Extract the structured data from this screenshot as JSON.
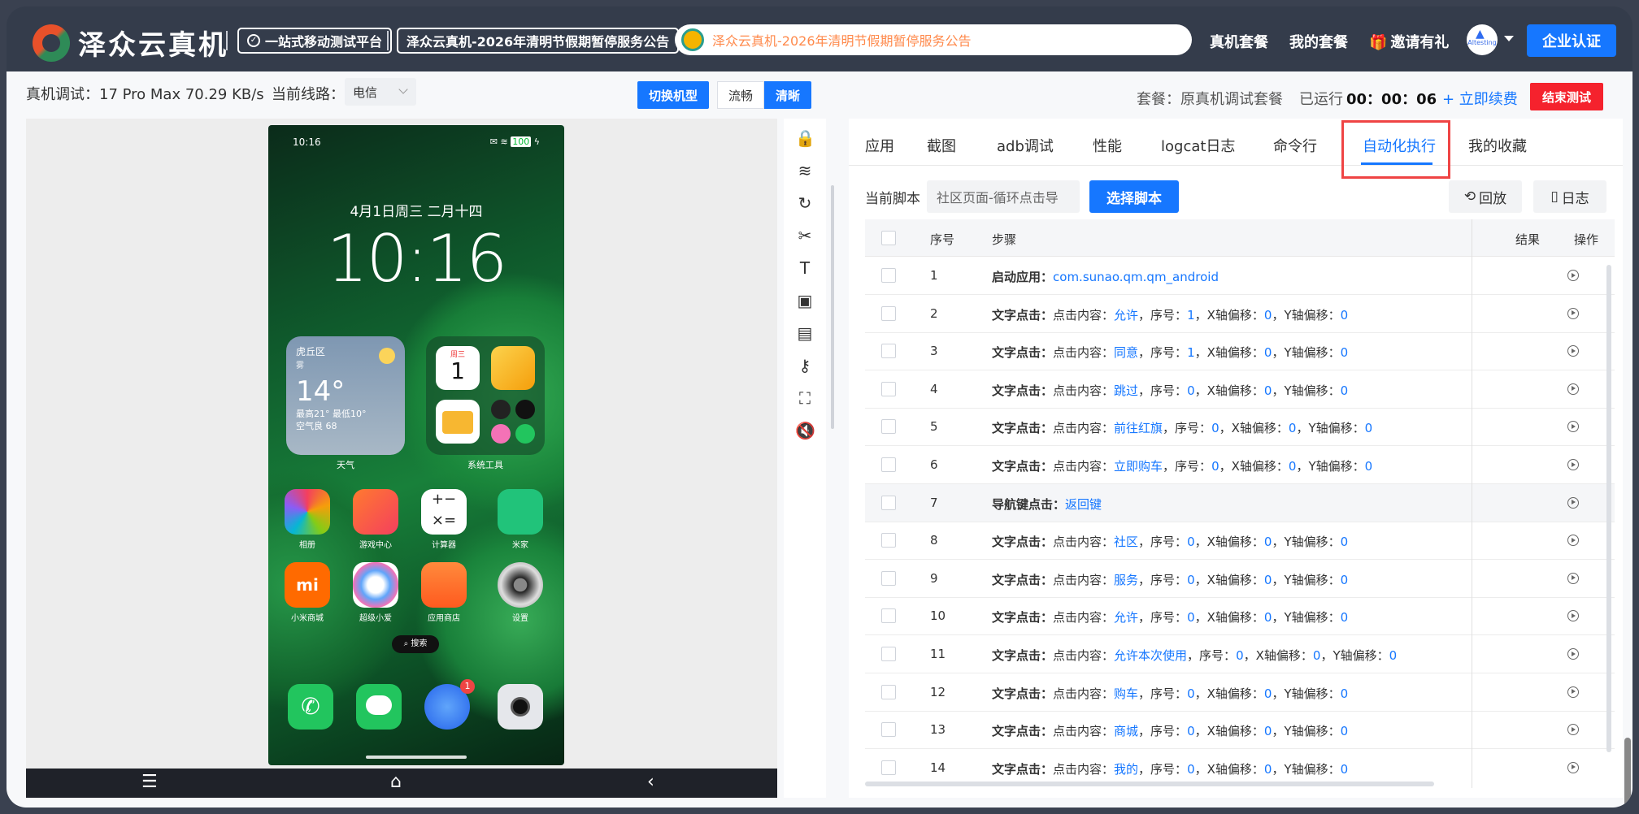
{
  "header": {
    "logo_text": "泽众云真机",
    "tagline": "一站式移动测试平台",
    "announcement_title": "泽众云真机-2026年清明节假期暂停服务公告",
    "notice_text": "泽众云真机-2026年清明节假期暂停服务公告",
    "nav": [
      "真机套餐",
      "我的套餐",
      "邀请有礼"
    ],
    "avatar_text": "Altesting",
    "enterprise_label": "企业认证"
  },
  "device_bar": {
    "info": "真机调试：17 Pro Max  70.29 KB/s",
    "line_label": "当前线路：",
    "line_value": "电信",
    "switch_label": "切换机型",
    "quality_smooth": "流畅",
    "quality_hd": "清晰"
  },
  "session": {
    "plan": "套餐：原真机调试套餐",
    "running_label": "已运行",
    "running_time": "00：00：06",
    "renew_label": "+ 立即续费",
    "end_label": "结束测试"
  },
  "phone": {
    "status_time": "10:16",
    "battery": "100",
    "date": "4月1日周三 二月十四",
    "clock": "10:16",
    "weather_city": "虎丘区",
    "weather_cond": "雾",
    "weather_temp": "14°",
    "weather_range": "最高21° 最低10°",
    "weather_aqi": "空气良 68",
    "weather_label": "天气",
    "tools_label": "系统工具",
    "cal_day": "周三",
    "cal_num": "1",
    "apps_row1": [
      "相册",
      "游戏中心",
      "计算器",
      "米家"
    ],
    "apps_row2": [
      "小米商城",
      "超级小爱",
      "应用商店",
      "设置"
    ],
    "search": "搜索",
    "badge": "1"
  },
  "tabs": [
    "应用",
    "截图",
    "adb调试",
    "性能",
    "logcat日志",
    "命令行",
    "自动化执行",
    "我的收藏"
  ],
  "script": {
    "label": "当前脚本",
    "value": "社区页面-循环点击导",
    "pick_label": "选择脚本",
    "replay_label": "回放",
    "log_label": "日志"
  },
  "table": {
    "columns": [
      "序号",
      "步骤",
      "结果",
      "操作"
    ],
    "rows": [
      {
        "no": "1",
        "type": "启动应用：",
        "text": "com.sunao.qm.qm_android"
      },
      {
        "no": "2",
        "type": "文字点击：",
        "content": "允许",
        "seq": "1",
        "x": "0",
        "y": "0"
      },
      {
        "no": "3",
        "type": "文字点击：",
        "content": "同意",
        "seq": "1",
        "x": "0",
        "y": "0"
      },
      {
        "no": "4",
        "type": "文字点击：",
        "content": "跳过",
        "seq": "0",
        "x": "0",
        "y": "0"
      },
      {
        "no": "5",
        "type": "文字点击：",
        "content": "前往红旗",
        "seq": "0",
        "x": "0",
        "y": "0"
      },
      {
        "no": "6",
        "type": "文字点击：",
        "content": "立即购车",
        "seq": "0",
        "x": "0",
        "y": "0"
      },
      {
        "no": "7",
        "type": "导航键点击：",
        "text": "返回键"
      },
      {
        "no": "8",
        "type": "文字点击：",
        "content": "社区",
        "seq": "0",
        "x": "0",
        "y": "0"
      },
      {
        "no": "9",
        "type": "文字点击：",
        "content": "服务",
        "seq": "0",
        "x": "0",
        "y": "0"
      },
      {
        "no": "10",
        "type": "文字点击：",
        "content": "允许",
        "seq": "0",
        "x": "0",
        "y": "0"
      },
      {
        "no": "11",
        "type": "文字点击：",
        "content": "允许本次使用",
        "seq": "0",
        "x": "0",
        "y": "0"
      },
      {
        "no": "12",
        "type": "文字点击：",
        "content": "购车",
        "seq": "0",
        "x": "0",
        "y": "0"
      },
      {
        "no": "13",
        "type": "文字点击：",
        "content": "商城",
        "seq": "0",
        "x": "0",
        "y": "0"
      },
      {
        "no": "14",
        "type": "文字点击：",
        "content": "我的",
        "seq": "0",
        "x": "0",
        "y": "0"
      }
    ],
    "labels": {
      "content": "点击内容：",
      "seq": "，序号：",
      "x": "，X轴偏移：",
      "y": "，Y轴偏移："
    }
  }
}
